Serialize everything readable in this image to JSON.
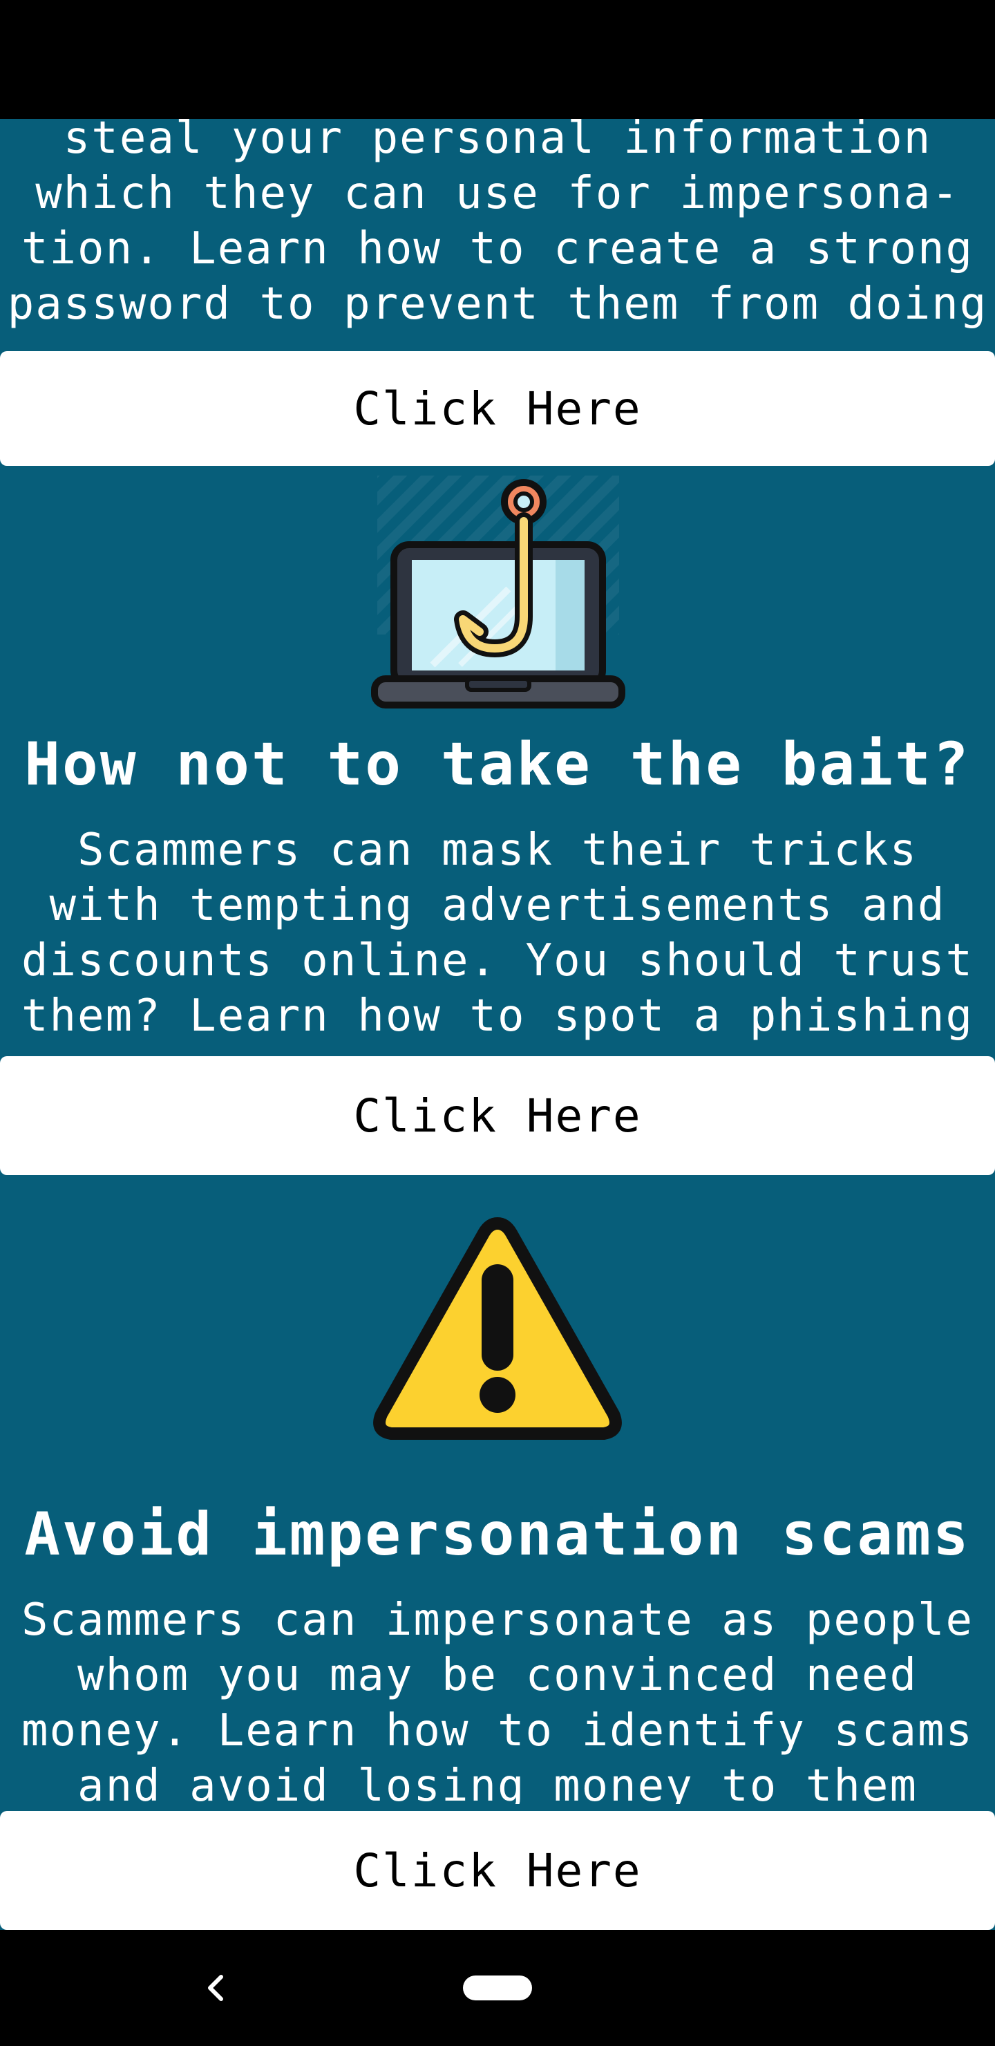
{
  "sections": [
    {
      "description_lines": [
        "steal your personal information",
        "which they can use for impersona-",
        "tion. Learn how to create a strong",
        "password to prevent them from doing"
      ],
      "button_label": "Click Here"
    },
    {
      "icon": "laptop-fishing-hook-icon",
      "heading": "How not to take the bait?",
      "description_lines": [
        "Scammers can mask their tricks",
        "with tempting advertisements and",
        "discounts online. You should trust",
        "them? Learn how to spot a phishing"
      ],
      "button_label": "Click Here"
    },
    {
      "icon": "warning-icon",
      "heading": "Avoid impersonation scams",
      "description_lines": [
        "Scammers can impersonate as people",
        "whom you may be convinced need",
        "money. Learn how to identify scams",
        "and avoid losing money to them"
      ],
      "button_label": "Click Here"
    }
  ],
  "navigation": {
    "back_icon": "chevron-left-icon",
    "home_icon": "home-pill-icon"
  },
  "colors": {
    "background": "#075e7a",
    "button": "#ffffff",
    "warning_yellow": "#fcd12f",
    "hook_yellow": "#f8d776",
    "hook_ring": "#f1875f",
    "screen_blue": "#c7eef7"
  }
}
